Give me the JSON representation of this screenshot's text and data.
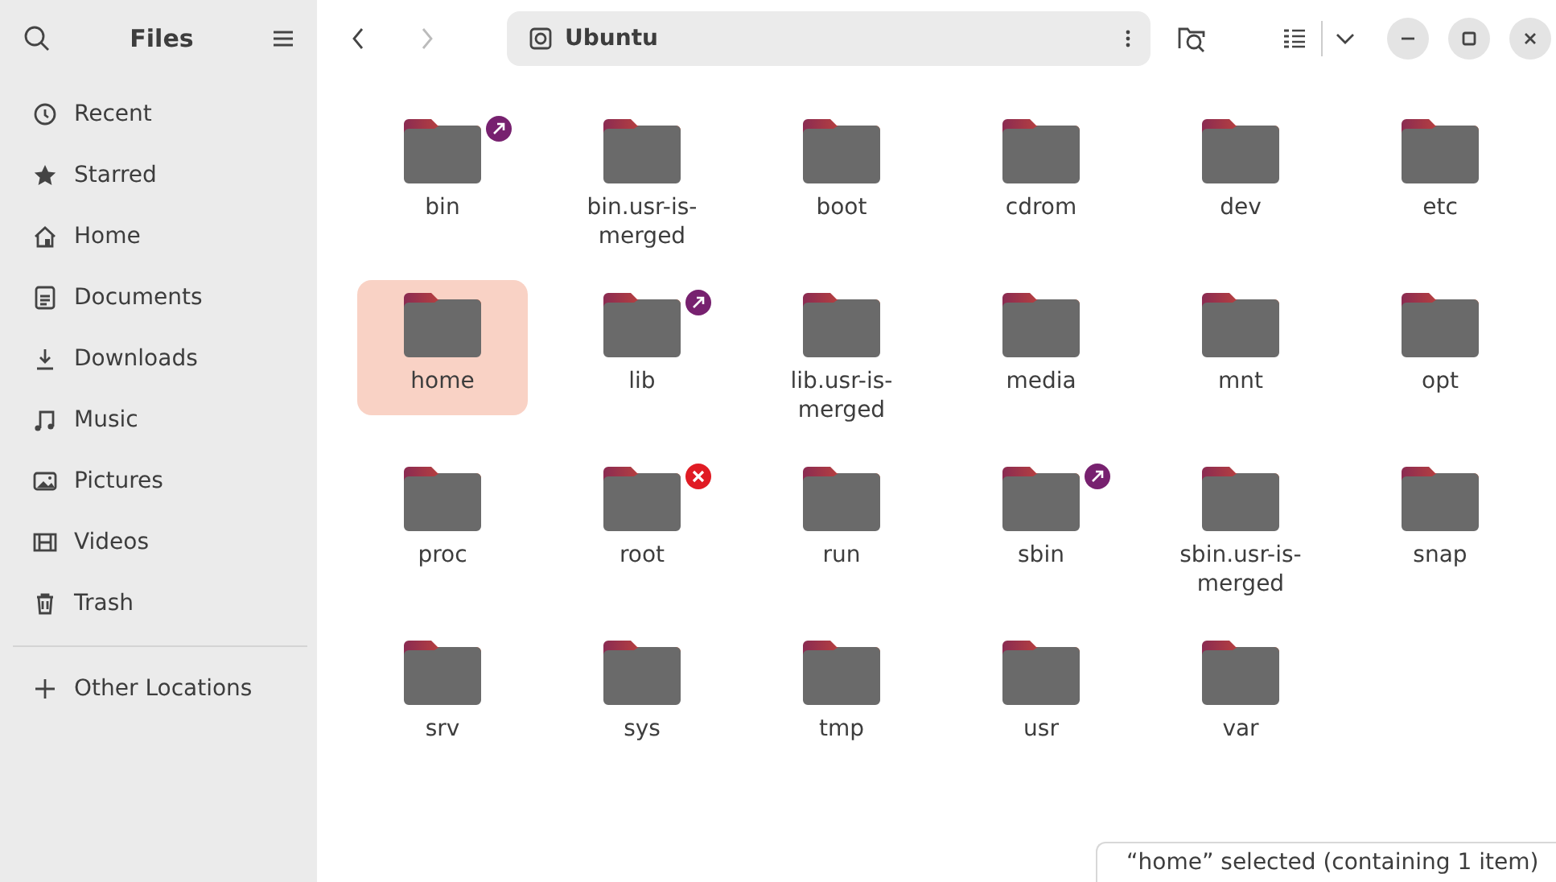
{
  "sidebar": {
    "title": "Files",
    "items": [
      {
        "label": "Recent",
        "selected": false
      },
      {
        "label": "Starred",
        "selected": false
      },
      {
        "label": "Home",
        "selected": false
      },
      {
        "label": "Documents",
        "selected": false
      },
      {
        "label": "Downloads",
        "selected": false
      },
      {
        "label": "Music",
        "selected": false
      },
      {
        "label": "Pictures",
        "selected": false
      },
      {
        "label": "Videos",
        "selected": false
      },
      {
        "label": "Trash",
        "selected": false
      }
    ],
    "other": {
      "label": "Other Locations"
    }
  },
  "path_bar": {
    "location": "Ubuntu"
  },
  "folders": [
    {
      "name": "bin",
      "selected": false,
      "kind": "link"
    },
    {
      "name": "bin.usr-is-merged",
      "selected": false,
      "kind": "folder"
    },
    {
      "name": "boot",
      "selected": false,
      "kind": "folder"
    },
    {
      "name": "cdrom",
      "selected": false,
      "kind": "folder"
    },
    {
      "name": "dev",
      "selected": false,
      "kind": "folder"
    },
    {
      "name": "etc",
      "selected": false,
      "kind": "folder"
    },
    {
      "name": "home",
      "selected": true,
      "kind": "folder"
    },
    {
      "name": "lib",
      "selected": false,
      "kind": "link"
    },
    {
      "name": "lib.usr-is-merged",
      "selected": false,
      "kind": "folder"
    },
    {
      "name": "media",
      "selected": false,
      "kind": "folder"
    },
    {
      "name": "mnt",
      "selected": false,
      "kind": "folder"
    },
    {
      "name": "opt",
      "selected": false,
      "kind": "folder"
    },
    {
      "name": "proc",
      "selected": false,
      "kind": "folder"
    },
    {
      "name": "root",
      "selected": false,
      "kind": "unreadable"
    },
    {
      "name": "run",
      "selected": false,
      "kind": "folder"
    },
    {
      "name": "sbin",
      "selected": false,
      "kind": "link"
    },
    {
      "name": "sbin.usr-is-merged",
      "selected": false,
      "kind": "folder"
    },
    {
      "name": "snap",
      "selected": false,
      "kind": "folder"
    },
    {
      "name": "srv",
      "selected": false,
      "kind": "folder"
    },
    {
      "name": "sys",
      "selected": false,
      "kind": "folder"
    },
    {
      "name": "tmp",
      "selected": false,
      "kind": "folder"
    },
    {
      "name": "usr",
      "selected": false,
      "kind": "folder"
    },
    {
      "name": "var",
      "selected": false,
      "kind": "folder"
    }
  ],
  "status_bar": "“home” selected  (containing 1 item)"
}
